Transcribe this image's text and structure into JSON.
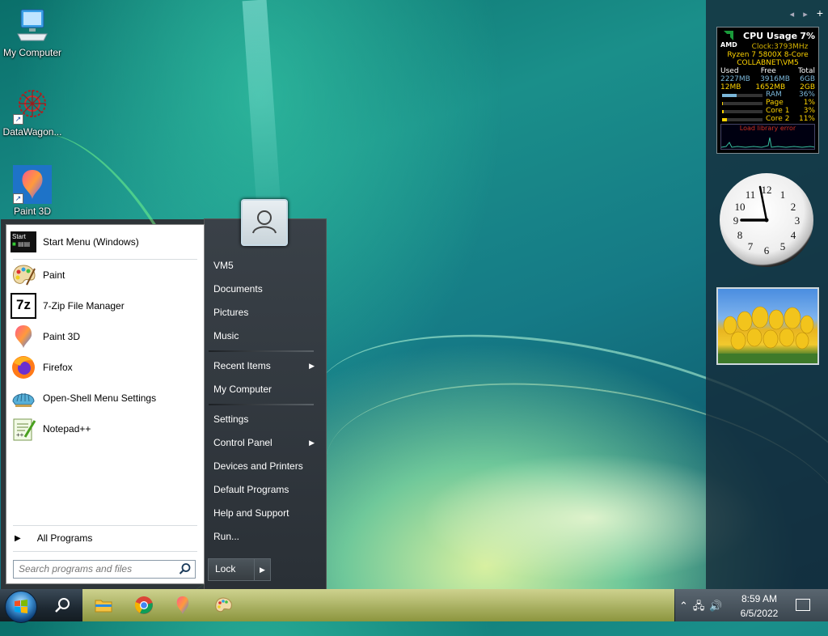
{
  "desktop": {
    "icons": [
      {
        "label": "My Computer"
      },
      {
        "label": "DataWagon..."
      },
      {
        "label": "Paint 3D"
      }
    ]
  },
  "sidebar": {
    "nav": {
      "prev": "◂",
      "next": "▸",
      "add": "+"
    },
    "cpu": {
      "brand": "AMD",
      "title": "CPU Usage",
      "percent": "7%",
      "clock": "Clock:3793MHz",
      "model": "Ryzen 7 5800X 8-Core",
      "host": "COLLABNET\\VM5",
      "headers": [
        "Used",
        "Free",
        "Total"
      ],
      "row1": [
        "2227MB",
        "3916MB",
        "6GB"
      ],
      "row2": [
        "12MB",
        "1652MB",
        "2GB"
      ],
      "meters": [
        {
          "label": "RAM",
          "value": "36%",
          "fill": 0.36
        },
        {
          "label": "Page",
          "value": "1%",
          "fill": 0.01
        },
        {
          "label": "Core 1",
          "value": "3%",
          "fill": 0.03
        },
        {
          "label": "Core 2",
          "value": "11%",
          "fill": 0.11
        }
      ],
      "graph_label": "Load library error"
    },
    "clock_time": "8:59"
  },
  "start_menu": {
    "programs": [
      {
        "label": "Start Menu (Windows)",
        "icon": "start-menu-icon"
      },
      {
        "label": "Paint",
        "icon": "paint-palette-icon"
      },
      {
        "label": "7-Zip File Manager",
        "icon": "7zip-icon"
      },
      {
        "label": "Paint 3D",
        "icon": "paint3d-icon"
      },
      {
        "label": "Firefox",
        "icon": "firefox-icon"
      },
      {
        "label": "Open-Shell Menu Settings",
        "icon": "open-shell-icon"
      },
      {
        "label": "Notepad++",
        "icon": "notepadpp-icon"
      }
    ],
    "all_programs": "All Programs",
    "search_placeholder": "Search programs and files",
    "right_items": [
      {
        "label": "VM5",
        "arrow": false
      },
      {
        "label": "Documents",
        "arrow": false
      },
      {
        "label": "Pictures",
        "arrow": false
      },
      {
        "label": "Music",
        "arrow": false
      },
      {
        "label": "Recent Items",
        "arrow": true
      },
      {
        "label": "My Computer",
        "arrow": false
      },
      {
        "label": "Settings",
        "arrow": false
      },
      {
        "label": "Control Panel",
        "arrow": true
      },
      {
        "label": "Devices and Printers",
        "arrow": false
      },
      {
        "label": "Default Programs",
        "arrow": false
      },
      {
        "label": "Help and Support",
        "arrow": false
      },
      {
        "label": "Run...",
        "arrow": false
      }
    ],
    "lock": "Lock"
  },
  "taskbar": {
    "pinned": [
      "search-icon",
      "file-explorer-icon",
      "chrome-icon",
      "paint3d-icon",
      "paint-palette-icon"
    ],
    "time": "8:59 AM",
    "date": "6/5/2022"
  }
}
